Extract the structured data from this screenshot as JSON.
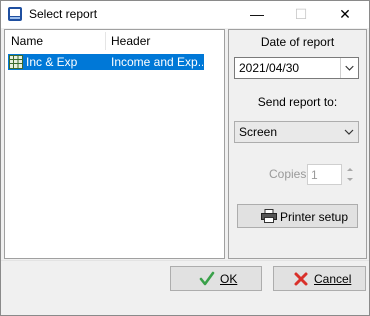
{
  "window": {
    "title": "Select report",
    "min_symbol": "—",
    "max_symbol": "☐",
    "close_symbol": "✕"
  },
  "report_list": {
    "columns": [
      "Name",
      "Header"
    ],
    "rows": [
      {
        "name": "Inc & Exp",
        "header": "Income and Exp...",
        "selected": true,
        "icon": "spreadsheet-icon"
      }
    ]
  },
  "options": {
    "date_label": "Date of report",
    "date_value": "2021/04/30",
    "send_label": "Send report to:",
    "destination_value": "Screen",
    "copies_label": "Copies:",
    "copies_value": "1",
    "printer_setup_label": "Printer setup"
  },
  "footer": {
    "ok_label": "OK",
    "cancel_label": "Cancel"
  },
  "colors": {
    "selection": "#0078d7",
    "ok_check": "#3aa14a",
    "cancel_x": "#d9302a"
  }
}
